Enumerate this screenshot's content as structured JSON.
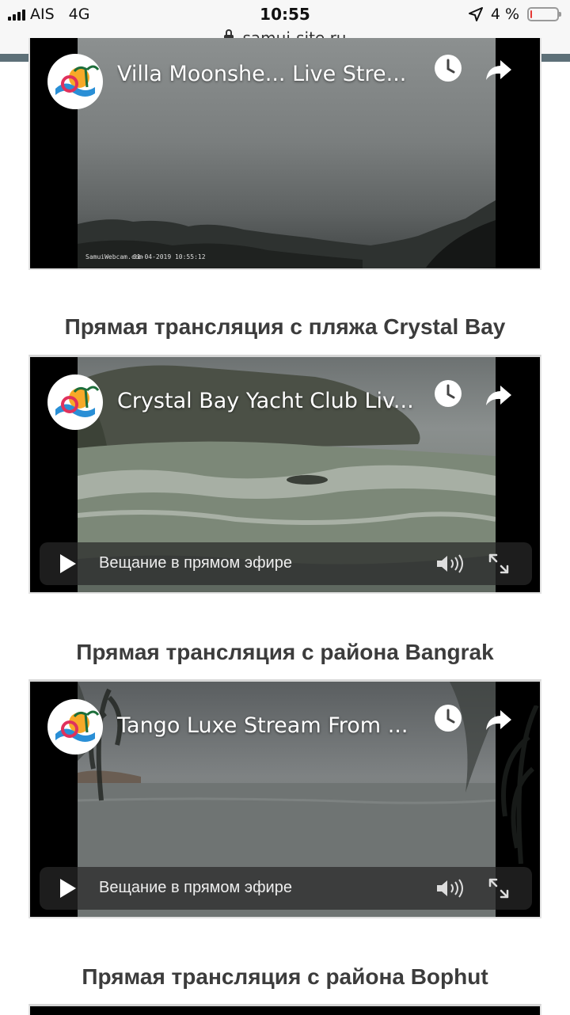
{
  "status_bar": {
    "carrier": "AIS",
    "network": "4G",
    "time": "10:55",
    "battery_percent": "4 %",
    "battery_color": "#e53935"
  },
  "browser": {
    "url": "samui-site.ru"
  },
  "videos": [
    {
      "title": "Villa Moonshe... Live Stre...",
      "watermark": "SamuiWebcam.com",
      "timestamp": "01-04-2019 10:55:12"
    },
    {
      "heading": "Прямая трансляция с пляжа Crystal Bay",
      "title": "Crystal Bay Yacht Club Liv...",
      "live_label": "Вещание в прямом эфире"
    },
    {
      "heading": "Прямая трансляция с района Bangrak",
      "title": "Tango Luxe Stream From ...",
      "live_label": "Вещание в прямом эфире"
    }
  ],
  "next_heading": "Прямая трансляция с района Bophut",
  "icons": [
    "signal-icon",
    "location-arrow-icon",
    "battery-icon",
    "lock-icon",
    "chevron-down-icon",
    "channel-logo-icon",
    "watch-later-icon",
    "share-icon",
    "play-icon",
    "volume-icon",
    "fullscreen-icon"
  ]
}
